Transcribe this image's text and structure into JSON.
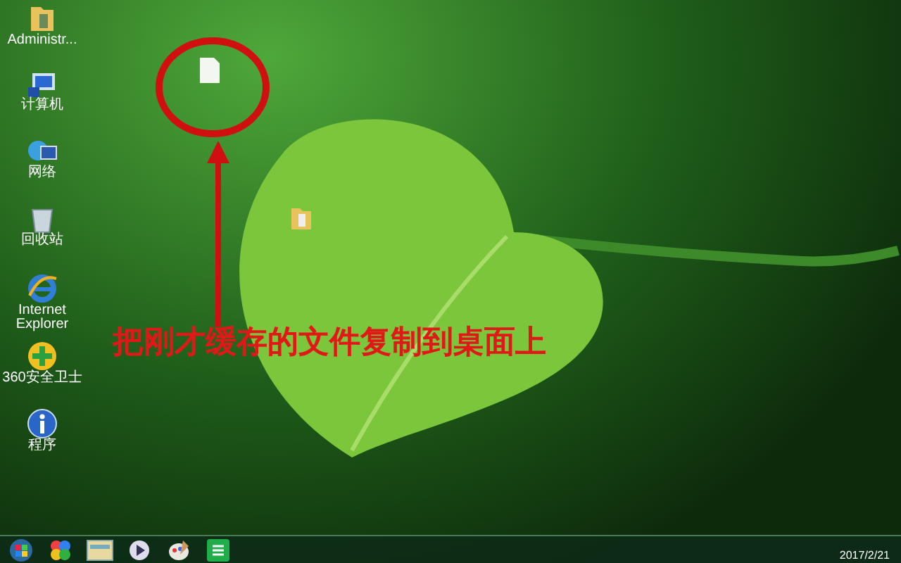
{
  "desktop_icons": [
    {
      "kind": "folder",
      "label": "Administr..."
    },
    {
      "kind": "computer",
      "label": "计算机"
    },
    {
      "kind": "network",
      "label": "网络"
    },
    {
      "kind": "recycle",
      "label": "回收站"
    },
    {
      "kind": "browser",
      "label": "Internet Explorer"
    },
    {
      "kind": "shield",
      "label": "360安全卫士"
    },
    {
      "kind": "info",
      "label": "程序"
    }
  ],
  "desktop_files": [
    {
      "kind": "document"
    },
    {
      "kind": "folder"
    }
  ],
  "annotation": {
    "text": "把刚才缓存的文件复制到桌面上"
  },
  "taskbar": {
    "items": [
      {
        "kind": "start"
      },
      {
        "kind": "pinwheel"
      },
      {
        "kind": "explorer"
      },
      {
        "kind": "media"
      },
      {
        "kind": "paint"
      },
      {
        "kind": "sheet"
      }
    ],
    "clock": "2017/2/21"
  }
}
